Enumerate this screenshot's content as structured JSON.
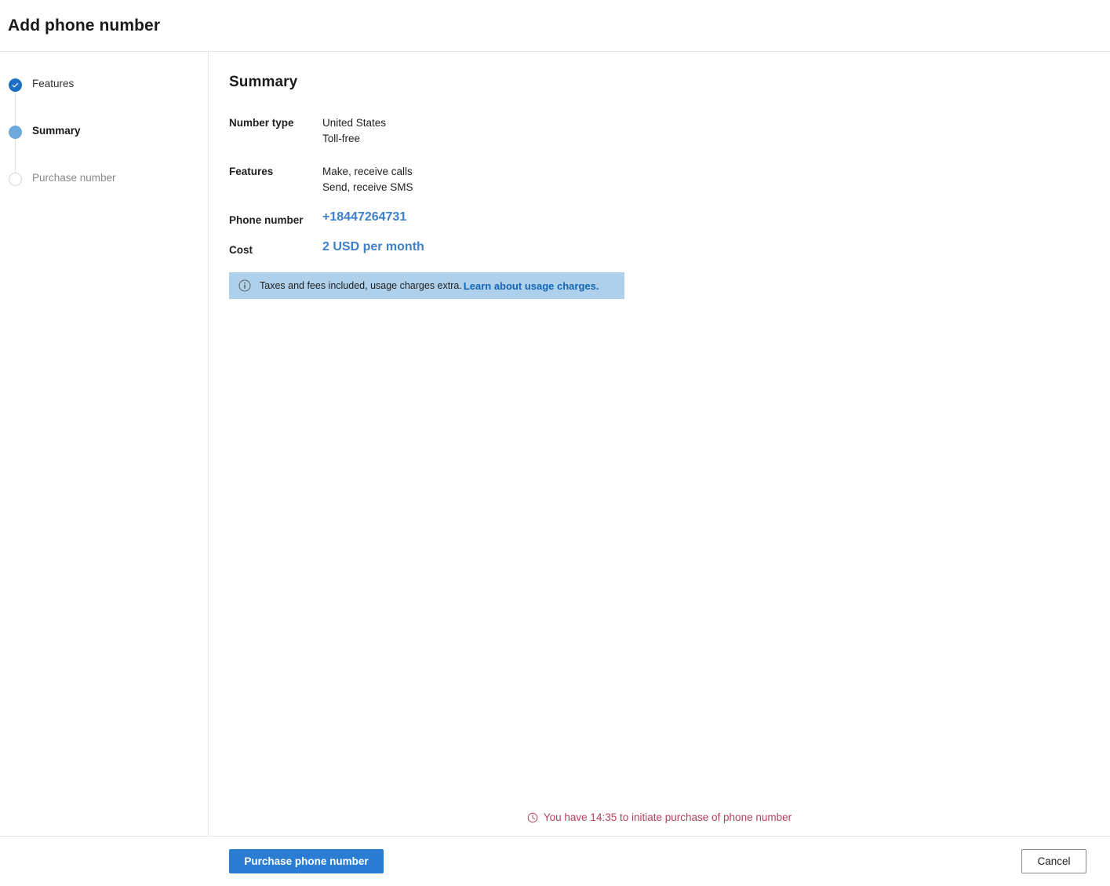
{
  "header": {
    "title": "Add phone number"
  },
  "wizard": {
    "steps": [
      {
        "label": "Features",
        "state": "done",
        "icon": "check-icon"
      },
      {
        "label": "Summary",
        "state": "current",
        "icon": "filled-circle-icon"
      },
      {
        "label": "Purchase number",
        "state": "todo",
        "icon": "empty-circle-icon"
      }
    ]
  },
  "summary": {
    "title": "Summary",
    "rows": [
      {
        "label": "Number type",
        "values": [
          "United States",
          "Toll-free"
        ],
        "style": "normal"
      },
      {
        "label": "Features",
        "values": [
          "Make, receive calls",
          "Send, receive SMS"
        ],
        "style": "normal"
      },
      {
        "label": "Phone number",
        "values": [
          "+18447264731"
        ],
        "style": "highlight"
      },
      {
        "label": "Cost",
        "values": [
          "2 USD per month"
        ],
        "style": "highlight"
      }
    ]
  },
  "info_banner": {
    "icon": "info-circle-icon",
    "text": "Taxes and fees included, usage charges extra.",
    "link_text": "Learn about usage charges."
  },
  "timer": {
    "icon": "clock-icon",
    "text": "You have 14:35 to initiate purchase of phone number",
    "remaining": "14:35"
  },
  "footer": {
    "primary_label": "Purchase phone number",
    "cancel_label": "Cancel"
  },
  "colors": {
    "accent": "#2b7cd3",
    "step_done": "#1c6ec2",
    "step_current": "#6fa8dc",
    "link": "#1267b4",
    "highlight_value": "#3d7fc8",
    "banner_bg": "#aed0ea",
    "timer_text": "#b4415c"
  }
}
